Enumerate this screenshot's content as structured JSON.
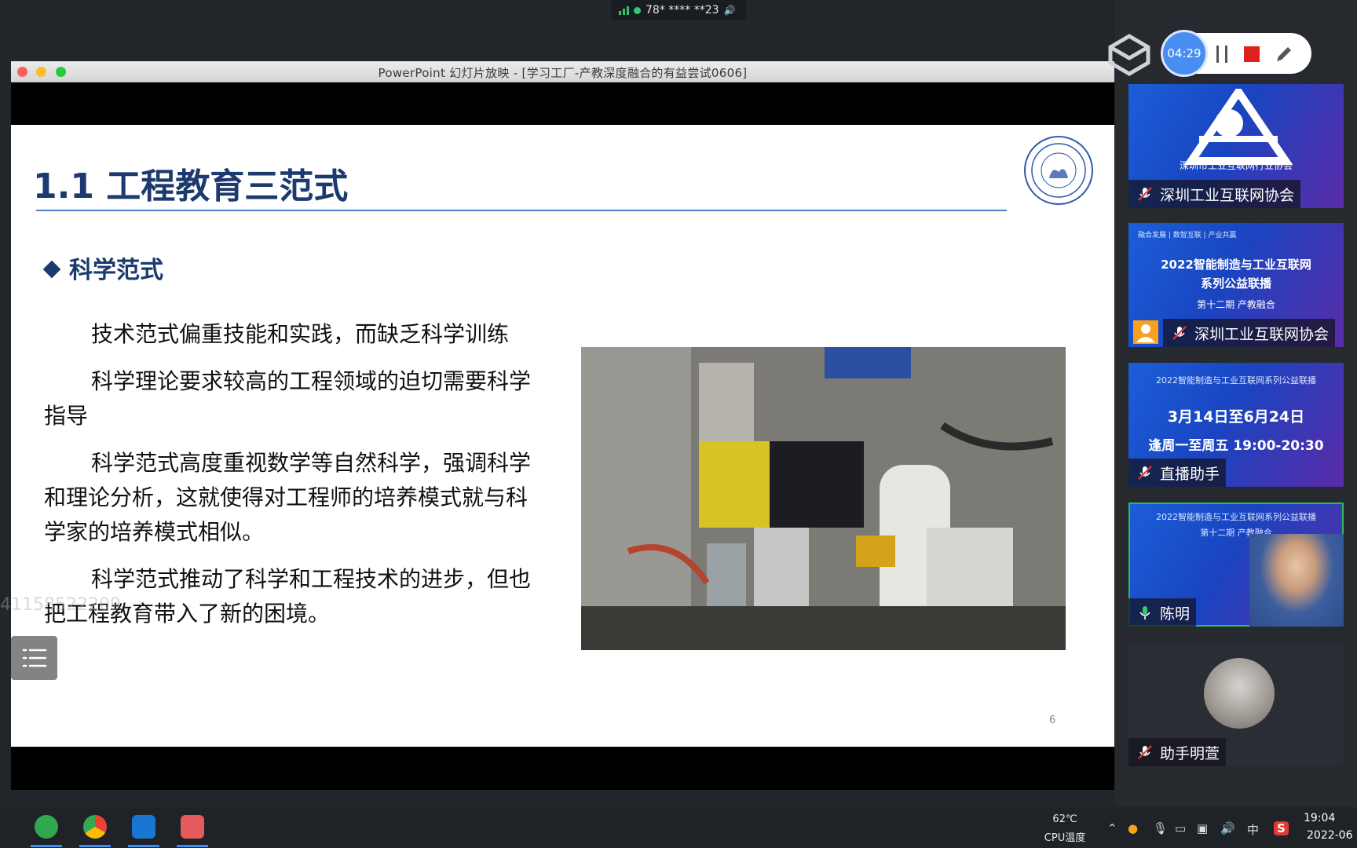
{
  "call": {
    "id": "78* **** **23"
  },
  "window": {
    "title": "PowerPoint 幻灯片放映 - [学习工厂-产教深度融合的有益尝试0606]"
  },
  "slide": {
    "title": "1.1 工程教育三范式",
    "subheading": "科学范式",
    "paragraphs": [
      "技术范式偏重技能和实践，而缺乏科学训练",
      "科学理论要求较高的工程领域的迫切需要科学指导",
      "科学范式高度重视数学等自然科学，强调科学和理论分析，这就使得对工程师的培养模式就与科学家的培养模式相似。",
      "科学范式推动了科学和工程技术的进步，但也把工程教育带入了新的困境。"
    ],
    "page_number": "6",
    "logo_text": "TONGJI UNIVERSITY",
    "logo_year": "1907"
  },
  "watermark": "41158522209",
  "recorder": {
    "timer": "04:29"
  },
  "participants": [
    {
      "name": "深圳工业互联网协会",
      "banner": "深圳市工业互联网行业协会",
      "mic": "off"
    },
    {
      "name": "深圳工业互联网协会",
      "banner_top": "融合发展 | 数智互联 | 产业共赢",
      "banner_line1": "2022智能制造与工业互联网",
      "banner_line2": "系列公益联播",
      "banner_line3": "第十二期 产教融合",
      "mic": "off"
    },
    {
      "name": "直播助手",
      "banner_line1": "2022智能制造与工业互联网系列公益联播",
      "banner_line2": "3月14日至6月24日",
      "banner_line3": "逢周一至周五 19:00-20:30",
      "mic": "off"
    },
    {
      "name": "陈明",
      "banner_line1": "2022智能制造与工业互联网系列公益联播",
      "banner_line2": "第十二期 产教融合",
      "mic": "on"
    },
    {
      "name": "助手明萱",
      "mic": "off"
    }
  ],
  "taskbar": {
    "temp_value": "62℃",
    "temp_label": "CPU温度",
    "ime": "中",
    "time": "19:04",
    "date": "2022-06"
  },
  "colors": {
    "slide_title": "#1d3a6e",
    "timer": "#4a8df0",
    "stop": "#e0201a",
    "tile_blue": "#1b5fd8"
  }
}
